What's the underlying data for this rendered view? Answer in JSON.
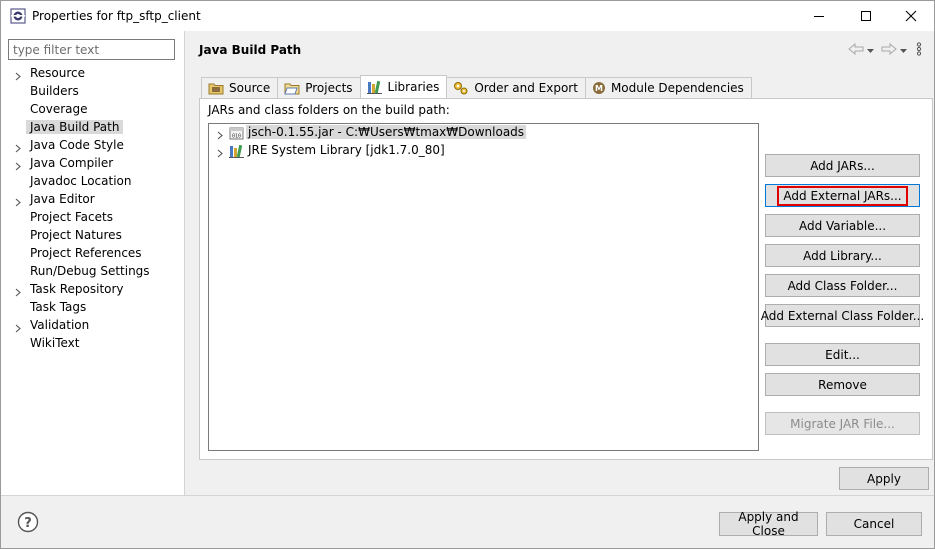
{
  "window": {
    "title": "Properties for ftp_sftp_client"
  },
  "filter": {
    "placeholder": "type filter text",
    "value": ""
  },
  "tree": {
    "items": [
      {
        "label": "Resource",
        "expandable": true
      },
      {
        "label": "Builders",
        "expandable": false
      },
      {
        "label": "Coverage",
        "expandable": false
      },
      {
        "label": "Java Build Path",
        "expandable": false,
        "selected": true
      },
      {
        "label": "Java Code Style",
        "expandable": true
      },
      {
        "label": "Java Compiler",
        "expandable": true
      },
      {
        "label": "Javadoc Location",
        "expandable": false
      },
      {
        "label": "Java Editor",
        "expandable": true
      },
      {
        "label": "Project Facets",
        "expandable": false
      },
      {
        "label": "Project Natures",
        "expandable": false
      },
      {
        "label": "Project References",
        "expandable": false
      },
      {
        "label": "Run/Debug Settings",
        "expandable": false
      },
      {
        "label": "Task Repository",
        "expandable": true
      },
      {
        "label": "Task Tags",
        "expandable": false
      },
      {
        "label": "Validation",
        "expandable": true
      },
      {
        "label": "WikiText",
        "expandable": false
      }
    ]
  },
  "page": {
    "title": "Java Build Path"
  },
  "tabs": [
    {
      "label": "Source",
      "icon": "source-folder-icon"
    },
    {
      "label": "Projects",
      "icon": "projects-folder-icon"
    },
    {
      "label": "Libraries",
      "icon": "libraries-icon",
      "active": true
    },
    {
      "label": "Order and Export",
      "icon": "order-export-icon"
    },
    {
      "label": "Module Dependencies",
      "icon": "module-icon"
    }
  ],
  "libraries": {
    "caption": "JARs and class folders on the build path:",
    "items": [
      {
        "label": "jsch-0.1.55.jar - C:₩Users₩tmax₩Downloads",
        "icon": "jar-icon",
        "selected": true
      },
      {
        "label": "JRE System Library [jdk1.7.0_80]",
        "icon": "jre-library-icon",
        "selected": false
      }
    ]
  },
  "buttons": {
    "add_jars": "Add JARs...",
    "add_external_jars": "Add External JARs...",
    "add_variable": "Add Variable...",
    "add_library": "Add Library...",
    "add_class_folder": "Add Class Folder...",
    "add_external_class_folder": "Add External Class Folder...",
    "edit": "Edit...",
    "remove": "Remove",
    "migrate_jar": "Migrate JAR File...",
    "apply": "Apply"
  },
  "footer": {
    "apply_and_close": "Apply and Close",
    "cancel": "Cancel"
  },
  "colors": {
    "highlight_border": "#e00000",
    "focus_border": "#0078d7",
    "selection": "#d9d9d9"
  }
}
